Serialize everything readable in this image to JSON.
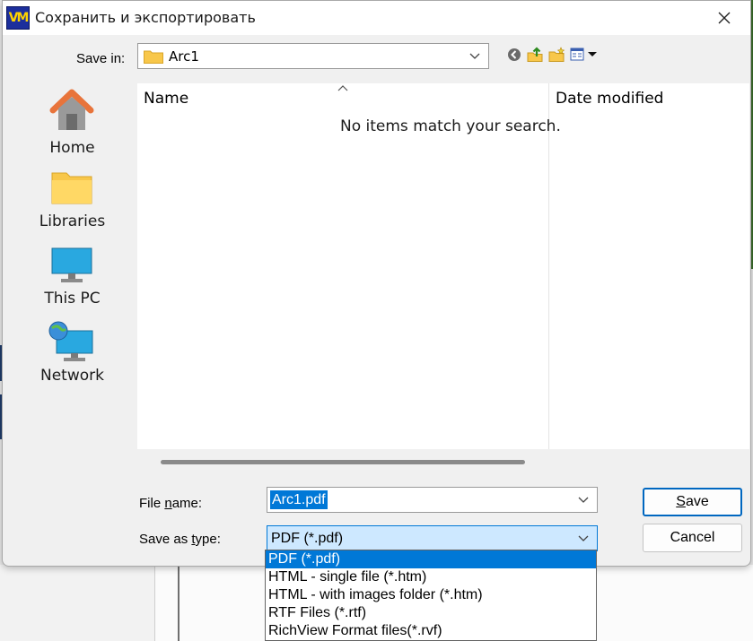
{
  "window": {
    "title": "Сохранить и экспортировать",
    "app_icon_text": "VM"
  },
  "toolbar": {
    "save_in_label": "Save in:",
    "save_in_value": "Arc1",
    "icons": [
      "back-icon",
      "up-folder-icon",
      "new-folder-icon",
      "view-menu-icon"
    ]
  },
  "places": [
    {
      "label": "Home",
      "icon": "home-icon"
    },
    {
      "label": "Libraries",
      "icon": "folder-icon"
    },
    {
      "label": "This PC",
      "icon": "monitor-icon"
    },
    {
      "label": "Network",
      "icon": "network-icon"
    }
  ],
  "filelist": {
    "columns": [
      "Name",
      "Date modified"
    ],
    "empty_message": "No items match your search."
  },
  "form": {
    "file_name_label": "File name:",
    "file_name_value": "Arc1.pdf",
    "save_type_label": "Save as type:",
    "save_type_value": "PDF (*.pdf)"
  },
  "buttons": {
    "save": "Save",
    "cancel": "Cancel"
  },
  "type_options": [
    "PDF (*.pdf)",
    "HTML - single file (*.htm)",
    "HTML - with images folder (*.htm)",
    "RTF Files (*.rtf)",
    "RichView Format files(*.rvf)"
  ],
  "type_selected_index": 0,
  "colors": {
    "accent": "#0078d7",
    "folder": "#f8c74a",
    "home_roof": "#e8743b"
  }
}
